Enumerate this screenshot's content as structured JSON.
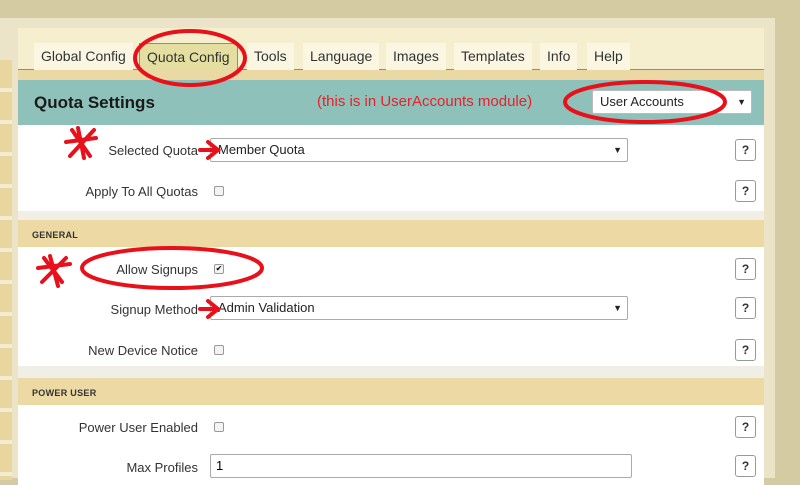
{
  "tabs": [
    {
      "label": "Global Config"
    },
    {
      "label": "Quota Config",
      "active": true
    },
    {
      "label": "Tools"
    },
    {
      "label": "Language"
    },
    {
      "label": "Images"
    },
    {
      "label": "Templates"
    },
    {
      "label": "Info"
    },
    {
      "label": "Help"
    }
  ],
  "header": {
    "title": "Quota Settings",
    "annotation": "(this is in UserAccounts module)",
    "module_select": "User Accounts"
  },
  "fields": {
    "selected_quota": {
      "label": "Selected Quota",
      "value": "Member Quota"
    },
    "apply_all": {
      "label": "Apply To All Quotas",
      "checked": false
    },
    "allow_signups": {
      "label": "Allow Signups",
      "checked": true
    },
    "signup_method": {
      "label": "Signup Method",
      "value": "Admin Validation"
    },
    "new_device": {
      "label": "New Device Notice",
      "checked": false
    },
    "power_user": {
      "label": "Power User Enabled",
      "checked": false
    },
    "max_profiles": {
      "label": "Max Profiles",
      "value": "1"
    }
  },
  "sections": {
    "general": "GENERAL",
    "power_user": "POWER USER"
  },
  "help_label": "?",
  "colors": {
    "header": "#8fc1bb",
    "section": "#ecd9a3",
    "annotation": "#e8202a"
  }
}
